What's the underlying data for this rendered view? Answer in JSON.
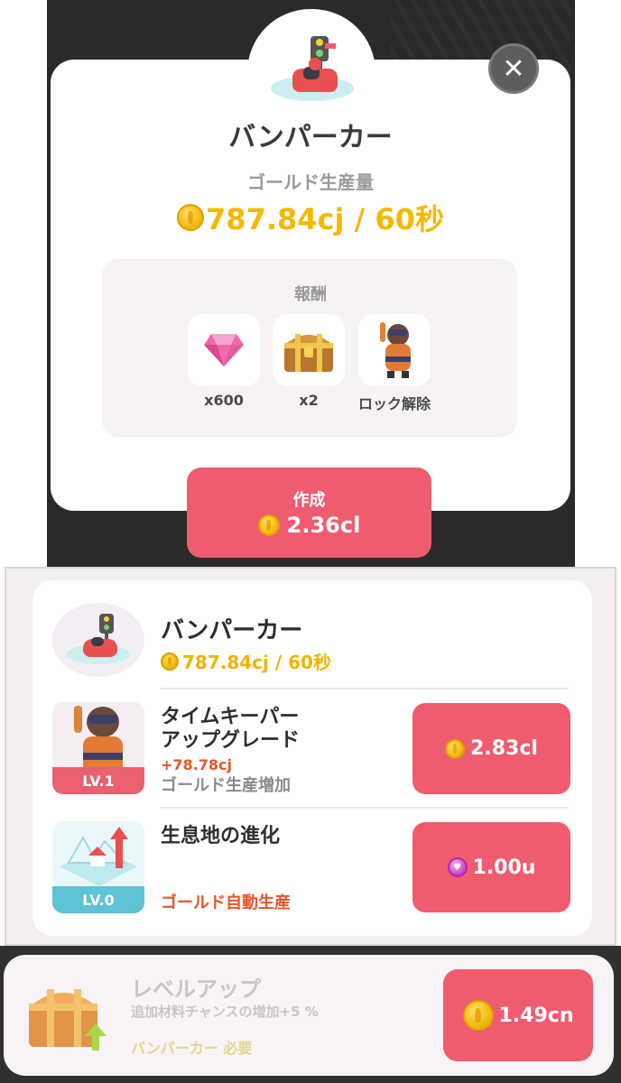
{
  "modal": {
    "title": "バンパーカー",
    "gold_label": "ゴールド生産量",
    "gold_rate": "787.84cj / 60秒",
    "close_symbol": "✕",
    "rewards": {
      "label": "報酬",
      "items": [
        {
          "icon": "gem-icon",
          "caption": "x600"
        },
        {
          "icon": "treasure-chest-icon",
          "caption": "x2"
        },
        {
          "icon": "timekeeper-character-icon",
          "caption": "ロック解除"
        }
      ]
    },
    "create_button": {
      "label": "作成",
      "cost": "2.36cl"
    }
  },
  "attraction": {
    "title": "バンパーカー",
    "rate": "787.84cj / 60秒"
  },
  "upgrades": [
    {
      "title_line1": "タイムキーパー",
      "title_line2": "アップグレード",
      "bonus": "+78.78cj",
      "effect": "ゴールド生産増加",
      "level": "LV.1",
      "cost": "2.83cl",
      "currency": "gold"
    },
    {
      "title_line1": "生息地の進化",
      "effect": "ゴールド自動生産",
      "level": "LV.0",
      "cost": "1.00u",
      "currency": "gem"
    }
  ],
  "level_up": {
    "title": "レベルアップ",
    "description": "追加材料チャンスの増加+5 %",
    "requirement": "バンパーカー 必要",
    "cost": "1.49cn"
  },
  "colors": {
    "accent_red": "#ef5c6f",
    "gold": "#f5b800",
    "bonus_orange": "#e8542a"
  }
}
